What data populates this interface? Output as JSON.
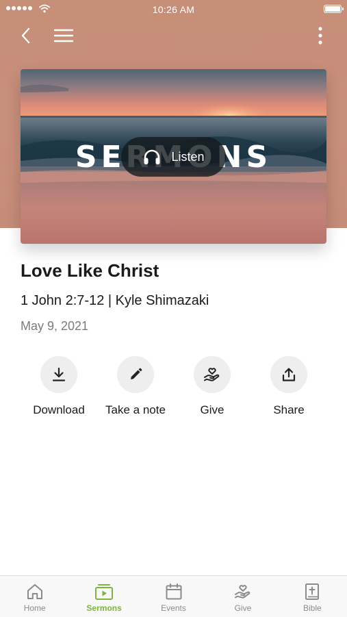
{
  "status_bar": {
    "time": "10:26 AM"
  },
  "hero": {
    "word": "SERMONS",
    "listen_label": "Listen"
  },
  "sermon": {
    "title": "Love Like Christ",
    "subtitle": "1 John 2:7-12 | Kyle Shimazaki",
    "date": "May 9, 2021"
  },
  "actions": [
    {
      "label": "Download",
      "icon": "download-icon"
    },
    {
      "label": "Take a note",
      "icon": "pencil-icon"
    },
    {
      "label": "Give",
      "icon": "give-hand-heart-icon"
    },
    {
      "label": "Share",
      "icon": "share-icon"
    }
  ],
  "tabs": [
    {
      "label": "Home",
      "icon": "home-icon"
    },
    {
      "label": "Sermons",
      "icon": "sermons-icon",
      "active": true
    },
    {
      "label": "Events",
      "icon": "calendar-icon"
    },
    {
      "label": "Give",
      "icon": "give-icon"
    },
    {
      "label": "Bible",
      "icon": "bible-icon"
    }
  ],
  "colors": {
    "header_bg": "#c78e78",
    "accent_active_tab": "#7fb33f",
    "action_circle_bg": "#eeeeee",
    "date_text": "#7b7b7b",
    "tab_inactive": "#8a8a8a"
  }
}
